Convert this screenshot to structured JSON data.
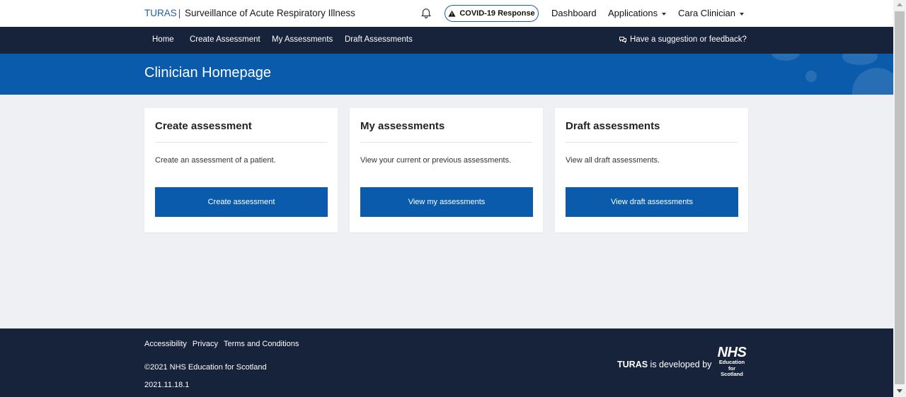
{
  "header": {
    "brand": "TURAS",
    "separator": "|",
    "app_name": "Surveillance of Acute Respiratory Illness",
    "notifications_icon": "bell-icon",
    "covid_label": "COVID-19 Response",
    "covid_icon": "warning-icon",
    "dashboard_label": "Dashboard",
    "applications_label": "Applications",
    "user_label": "Cara Clinician"
  },
  "nav": {
    "items": [
      {
        "label": "Home"
      },
      {
        "label": "Create Assessment"
      },
      {
        "label": "My Assessments"
      },
      {
        "label": "Draft Assessments"
      }
    ],
    "feedback_label": "Have a suggestion or feedback?",
    "feedback_icon": "comments-icon"
  },
  "banner": {
    "title": "Clinician Homepage"
  },
  "cards": [
    {
      "title": "Create assessment",
      "description": "Create an assessment of a patient.",
      "button": "Create assessment"
    },
    {
      "title": "My assessments",
      "description": "View your current or previous assessments.",
      "button": "View my assessments"
    },
    {
      "title": "Draft assessments",
      "description": "View all draft assessments.",
      "button": "View draft assessments"
    }
  ],
  "footer": {
    "links": [
      {
        "label": "Accessibility"
      },
      {
        "label": "Privacy"
      },
      {
        "label": "Terms and Conditions"
      }
    ],
    "copyright": "©2021 NHS Education for Scotland",
    "version": "2021.11.18.1",
    "developed_brand": "TURAS",
    "developed_text": " is developed by",
    "logo_nhs": "NHS",
    "logo_line1": "Education",
    "logo_line2": "for",
    "logo_line3": "Scotland"
  },
  "colors": {
    "primary": "#0a5bab",
    "navy": "#16233a",
    "background": "#eef0f4"
  }
}
